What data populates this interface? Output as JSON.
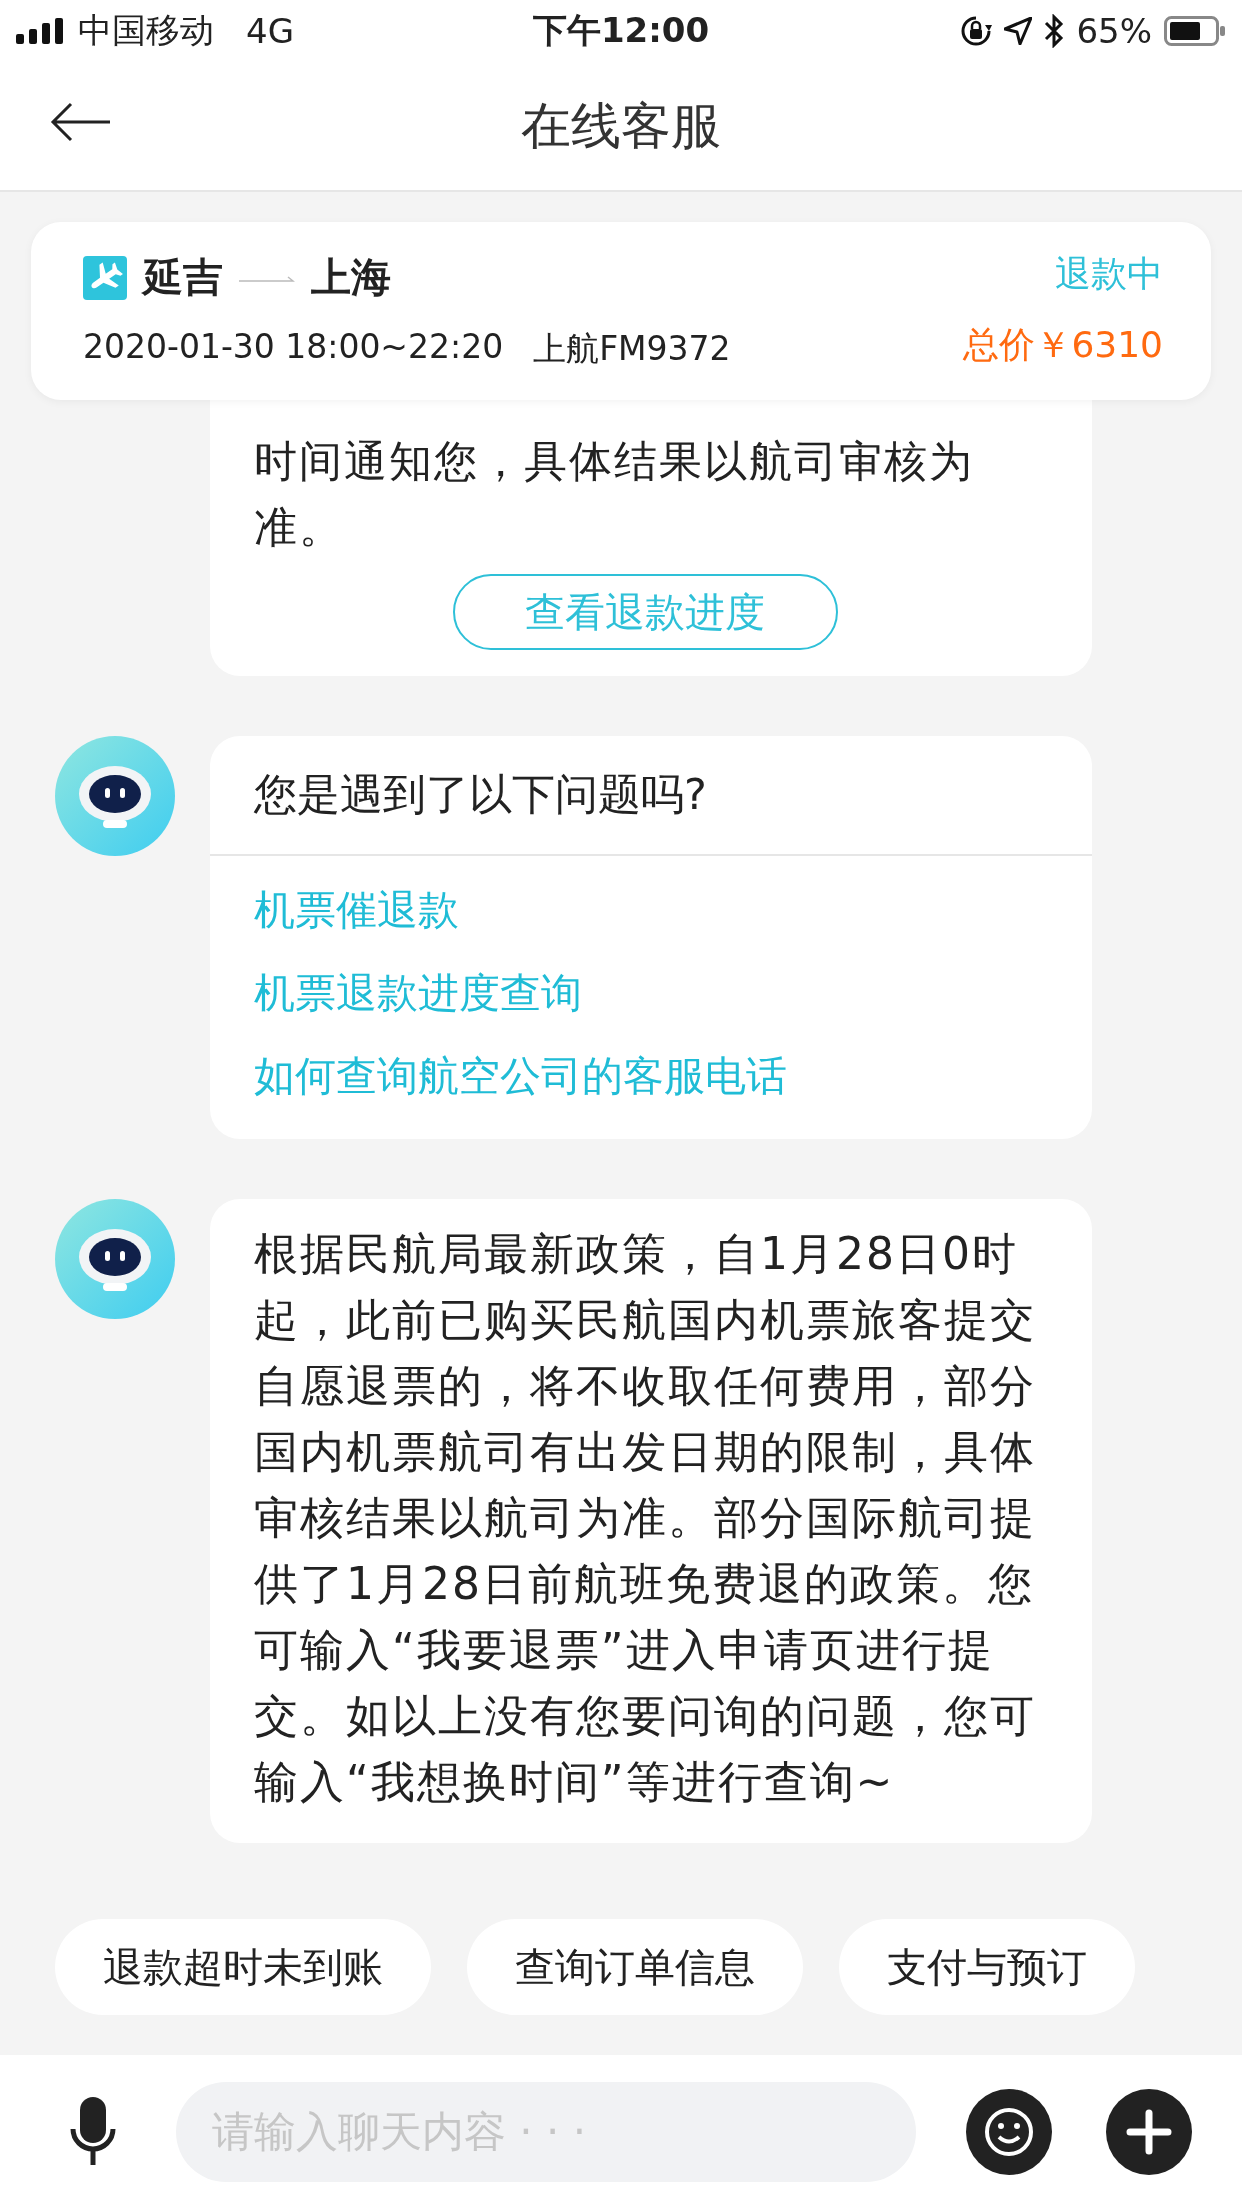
{
  "status_bar": {
    "carrier": "中国移动",
    "network": "4G",
    "time": "下午12:00",
    "battery": "65%"
  },
  "nav": {
    "title": "在线客服"
  },
  "order_card": {
    "origin": "延吉",
    "destination": "上海",
    "schedule": "2020-01-30 18:00~22:20",
    "flight": "上航FM9372",
    "status": "退款中",
    "price": "总价￥6310"
  },
  "messages": [
    {
      "kind": "text_button",
      "avatar": false,
      "text": "时间通知您，具体结果以航司审核为准。",
      "button": "查看退款进度"
    },
    {
      "kind": "question_list",
      "avatar": true,
      "title": "您是遇到了以下问题吗?",
      "options": [
        "机票催退款",
        "机票退款进度查询",
        "如何查询航空公司的客服电话"
      ]
    },
    {
      "kind": "text",
      "avatar": true,
      "text": "根据民航局最新政策，自1月28日0时起，此前已购买民航国内机票旅客提交自愿退票的，将不收取任何费用，部分国内机票航司有出发日期的限制，具体审核结果以航司为准。部分国际航司提供了1月28日前航班免费退的政策。您可输入“我要退票”进入申请页进行提交。如以上没有您要问询的问题，您可输入“我想换时间”等进行查询~"
    }
  ],
  "quick_replies": [
    "退款超时未到账",
    "查询订单信息",
    "支付与预订"
  ],
  "input": {
    "placeholder": "请输入聊天内容 · · ·"
  }
}
